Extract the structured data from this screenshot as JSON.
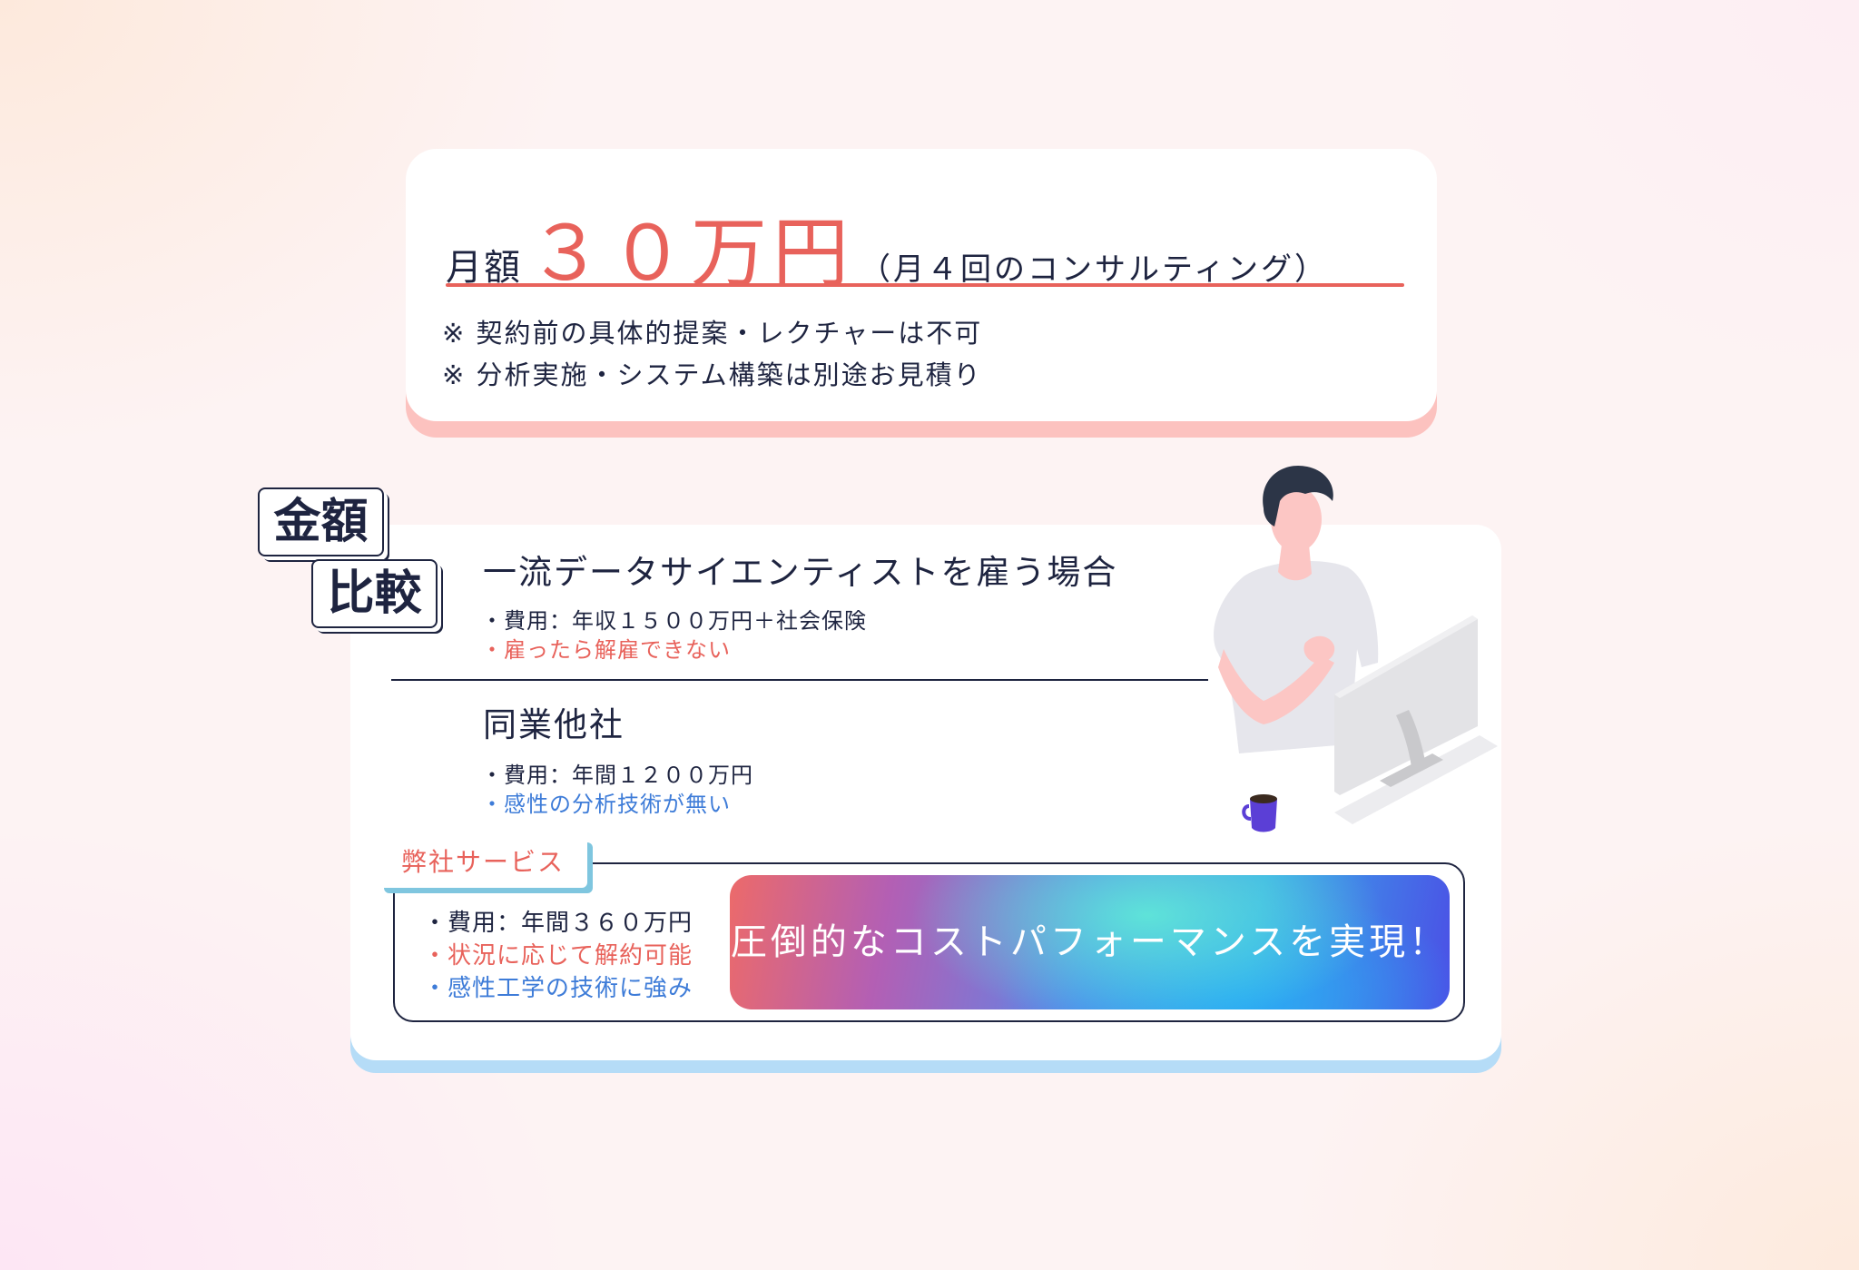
{
  "price_card": {
    "prefix": "月額",
    "amount": "３０万円",
    "note": "（月４回のコンサルティング）",
    "notes": [
      "※ 契約前の具体的提案・レクチャーは不可",
      "※ 分析実施・システム構築は別途お見積り"
    ]
  },
  "tags": [
    "金額",
    "比較"
  ],
  "comparison": {
    "option1": {
      "title": "一流データサイエンティストを雇う場合",
      "bullets": [
        "・費用：年収１５００万円＋社会保険",
        "・雇ったら解雇できない"
      ]
    },
    "option2": {
      "title": "同業他社",
      "bullets": [
        "・費用：年間１２００万円",
        "・感性の分析技術が無い"
      ]
    }
  },
  "service": {
    "tab": "弊社サービス",
    "bullets": [
      "・費用：年間３６０万円",
      "・状況に応じて解約可能",
      "・感性工学の技術に強み"
    ],
    "cta": "圧倒的なコストパフォーマンスを実現！"
  },
  "colors": {
    "accent_red": "#e8625b",
    "accent_blue": "#3e7cd8",
    "ink": "#1e2440",
    "price_shadow": "#fcc2bf",
    "card_shadow": "#b5dcf7"
  }
}
